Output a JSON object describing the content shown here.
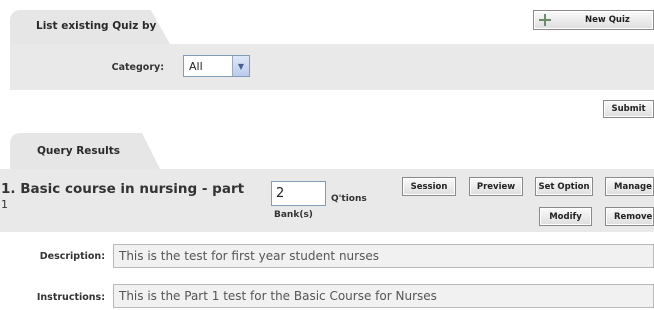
{
  "search": {
    "tab_label": "List existing Quiz by",
    "category_label": "Category:",
    "category_value": "All",
    "new_quiz_label": "New Quiz",
    "submit_label": "Submit"
  },
  "results": {
    "tab_label": "Query Results",
    "quiz": {
      "title_line1": "1. Basic course in nursing - part",
      "title_line2": "1",
      "bank_count": "2",
      "qtions_label": "Q'tions",
      "bank_label": "Bank(s)",
      "buttons": {
        "session": "Session",
        "preview": "Preview",
        "set_option": "Set Option",
        "manage": "Manage",
        "modify": "Modify",
        "remove": "Remove"
      },
      "description_label": "Description:",
      "description_value": "This is the test for first year student nurses",
      "instructions_label": "Instructions:",
      "instructions_value": "This is the Part 1 test for the Basic Course for Nurses"
    }
  }
}
